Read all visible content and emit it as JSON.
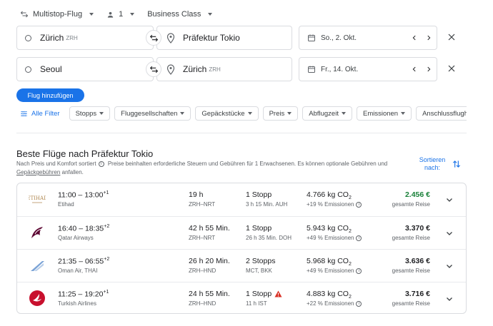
{
  "search": {
    "trip_type": "Multistop-Flug",
    "passengers": "1",
    "cabin": "Business Class",
    "legs": [
      {
        "from_city": "Zürich",
        "from_code": "ZRH",
        "to_city": "Präfektur Tokio",
        "to_code": "",
        "date": "So., 2. Okt."
      },
      {
        "from_city": "Seoul",
        "from_code": "",
        "to_city": "Zürich",
        "to_code": "ZRH",
        "date": "Fr., 14. Okt."
      }
    ],
    "add_flight_label": "Flug hinzufügen"
  },
  "filters": {
    "all_label": "Alle Filter",
    "chips": [
      "Stopps",
      "Fluggesellschaften",
      "Gepäckstücke",
      "Preis",
      "Abflugzeit",
      "Emissionen",
      "Anschlussflughäfen"
    ]
  },
  "results": {
    "title": "Beste Flüge nach Präfektur Tokio",
    "sorted_by": "Nach Preis und Komfort sortiert",
    "tax_note": "Preise beinhalten erforderliche Steuern und Gebühren für 1 Erwachsenen. Es können optionale Gebühren und",
    "fees_link": "Gepäckgebühren",
    "fees_suffix": "anfallen.",
    "sort_label": "Sortieren nach:",
    "co2_unit": "CO",
    "co2_sub": "2",
    "price_type": "gesamte Reise",
    "flights": [
      {
        "dep": "11:00",
        "arr": "13:00",
        "day_offset": "+1",
        "airline": "Etihad",
        "duration": "19 h",
        "route": "ZRH–NRT",
        "stops": "1 Stopp",
        "stop_detail": "3 h 15 Min. AUH",
        "co2": "4.766 kg",
        "emissions": "+19 % Emissionen",
        "price": "2.456 €",
        "warning": false,
        "price_color": "#188038"
      },
      {
        "dep": "16:40",
        "arr": "18:35",
        "day_offset": "+2",
        "airline": "Qatar Airways",
        "duration": "42 h 55 Min.",
        "route": "ZRH–NRT",
        "stops": "1 Stopp",
        "stop_detail": "26 h 35 Min. DOH",
        "co2": "5.943 kg",
        "emissions": "+49 % Emissionen",
        "price": "3.370 €",
        "warning": false,
        "price_color": "#202124"
      },
      {
        "dep": "21:35",
        "arr": "06:55",
        "day_offset": "+2",
        "airline": "Oman Air, THAI",
        "duration": "26 h 20 Min.",
        "route": "ZRH–HND",
        "stops": "2 Stopps",
        "stop_detail": "MCT, BKK",
        "co2": "5.968 kg",
        "emissions": "+49 % Emissionen",
        "price": "3.636 €",
        "warning": false,
        "price_color": "#202124"
      },
      {
        "dep": "11:25",
        "arr": "19:20",
        "day_offset": "+1",
        "airline": "Turkish Airlines",
        "duration": "24 h 55 Min.",
        "route": "ZRH–HND",
        "stops": "1 Stopp",
        "stop_detail": "11 h IST",
        "co2": "4.883 kg",
        "emissions": "+22 % Emissionen",
        "price": "3.716 €",
        "warning": true,
        "price_color": "#202124"
      }
    ]
  },
  "icons": {
    "swap": "swap-arrows-icon",
    "pin": "location-pin-icon",
    "calendar": "calendar-icon",
    "close": "close-icon",
    "expand": "chevron-down-icon",
    "filter": "tune-icon",
    "sort": "sort-arrows-icon",
    "warning": "warning-icon"
  },
  "colors": {
    "accent": "#1a73e8",
    "warning": "#d93025",
    "cheapest": "#188038"
  }
}
